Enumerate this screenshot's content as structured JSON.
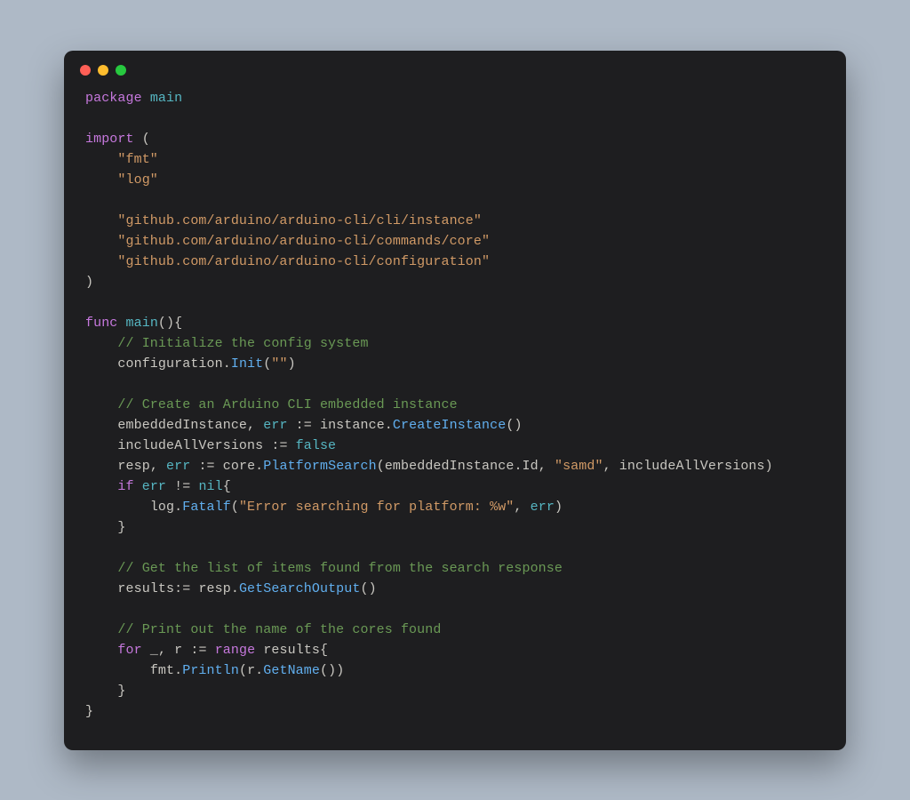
{
  "language": "go",
  "theme": {
    "background": "#1e1e20",
    "keyword": "#c678dd",
    "identifier": "#56b6c2",
    "function": "#61afef",
    "string": "#d19a66",
    "comment": "#6a9955",
    "plain": "#c9c7c1"
  },
  "window": {
    "traffic_lights": [
      "red",
      "yellow",
      "green"
    ]
  },
  "tokens": {
    "kw_package": "package",
    "kw_import": "import",
    "kw_func": "func",
    "kw_if": "if",
    "kw_for": "for",
    "kw_range": "range",
    "id_main": "main",
    "id_err": "err",
    "id_nil": "nil",
    "id_false": "false",
    "str_fmt": "\"fmt\"",
    "str_log": "\"log\"",
    "str_imp_instance": "\"github.com/arduino/arduino-cli/cli/instance\"",
    "str_imp_core": "\"github.com/arduino/arduino-cli/commands/core\"",
    "str_imp_conf": "\"github.com/arduino/arduino-cli/configuration\"",
    "cm_init": "// Initialize the config system",
    "cm_create": "// Create an Arduino CLI embedded instance",
    "cm_getlist": "// Get the list of items found from the search response",
    "cm_print": "// Print out the name of the cores found",
    "obj_configuration": "configuration",
    "fn_Init": "Init",
    "str_empty": "\"\"",
    "id_embeddedInstance": "embeddedInstance",
    "obj_instance": "instance",
    "fn_CreateInstance": "CreateInstance",
    "id_includeAllVersions": "includeAllVersions",
    "id_resp": "resp",
    "obj_core": "core",
    "fn_PlatformSearch": "PlatformSearch",
    "prop_Id": "Id",
    "str_samd": "\"samd\"",
    "obj_log": "log",
    "fn_Fatalf": "Fatalf",
    "str_errfmt": "\"Error searching for platform: %w\"",
    "id_results": "results",
    "fn_GetSearchOutput": "GetSearchOutput",
    "id_underscore": "_",
    "id_r": "r",
    "obj_fmt": "fmt",
    "fn_Println": "Println",
    "fn_GetName": "GetName",
    "p_open": "(",
    "p_close": ")",
    "b_open": "{",
    "b_close": "}",
    "dot": ".",
    "comma": ",",
    "space": " ",
    "assign": ":=",
    "neq": "!="
  }
}
